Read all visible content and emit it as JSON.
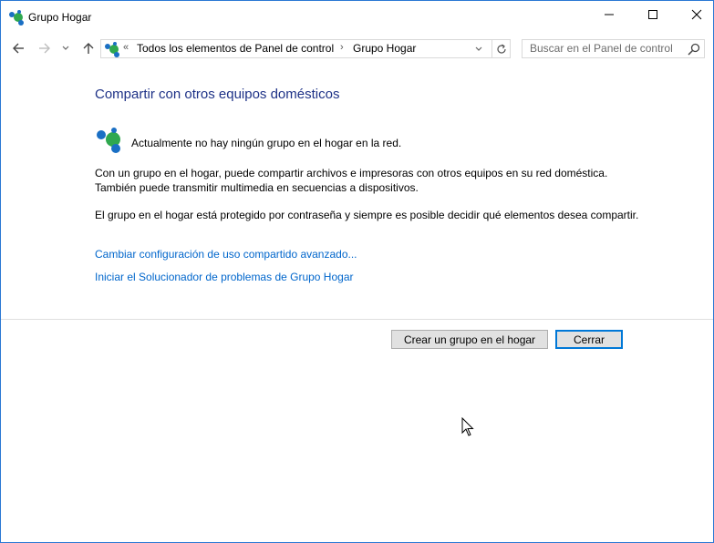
{
  "window": {
    "title": "Grupo Hogar",
    "accent_color": "#2b78d4"
  },
  "caption": {
    "minimize_icon": "minimize-icon",
    "maximize_icon": "maximize-icon",
    "close_icon": "close-icon"
  },
  "nav": {
    "back_icon": "back-arrow-icon",
    "forward_icon": "forward-arrow-icon",
    "recent_icon": "chevron-down-icon",
    "up_icon": "up-arrow-icon"
  },
  "address": {
    "overflow": "«",
    "crumbs": [
      "Todos los elementos de Panel de control",
      "Grupo Hogar"
    ],
    "separator": "›"
  },
  "search": {
    "placeholder": "Buscar en el Panel de control"
  },
  "content": {
    "heading": "Compartir con otros equipos domésticos",
    "status": "Actualmente no hay ningún grupo en el hogar en la red.",
    "paragraph1": "Con un grupo en el hogar, puede compartir archivos e impresoras con otros equipos en su red doméstica. También puede transmitir multimedia en secuencias a dispositivos.",
    "paragraph2": "El grupo en el hogar está protegido por contraseña y siempre es posible decidir qué elementos desea compartir.",
    "link_advanced": "Cambiar configuración de uso compartido avanzado...",
    "link_troubleshoot": "Iniciar el Solucionador de problemas de Grupo Hogar",
    "heading_color": "#1e3287",
    "link_color": "#0066cc"
  },
  "buttons": {
    "create": "Crear un grupo en el hogar",
    "close": "Cerrar"
  }
}
